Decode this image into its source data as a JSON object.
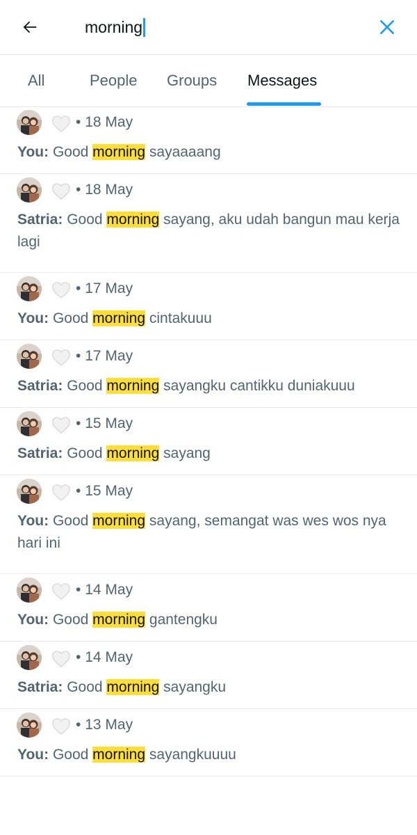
{
  "search": {
    "query": "morning"
  },
  "tabs": [
    {
      "label": "All"
    },
    {
      "label": "People"
    },
    {
      "label": "Groups"
    },
    {
      "label": "Messages"
    }
  ],
  "active_tab": "Messages",
  "colors": {
    "accent": "#1d9bf0",
    "highlight": "#ffde35",
    "secondary_text": "#536471",
    "divider": "#e7e9ea"
  },
  "results": [
    {
      "date": "18 May",
      "sender": "You:",
      "before": "Good",
      "match": "morning",
      "after": "sayaaaang"
    },
    {
      "date": "18 May",
      "sender": "Satria:",
      "before": "Good",
      "match": "morning",
      "after": "sayang, aku udah bangun mau kerja lagi"
    },
    {
      "date": "17 May",
      "sender": "You:",
      "before": "Good",
      "match": "morning",
      "after": "cintakuuu"
    },
    {
      "date": "17 May",
      "sender": "Satria:",
      "before": "Good",
      "match": "morning",
      "after": "sayangku cantikku duniakuuu"
    },
    {
      "date": "15 May",
      "sender": "Satria:",
      "before": "Good",
      "match": "morning",
      "after": "sayang"
    },
    {
      "date": "15 May",
      "sender": "You:",
      "before": "Good",
      "match": "morning",
      "after": "sayang, semangat was wes wos nya hari ini"
    },
    {
      "date": "14 May",
      "sender": "You:",
      "before": "Good",
      "match": "morning",
      "after": "gantengku"
    },
    {
      "date": "14 May",
      "sender": "Satria:",
      "before": "Good",
      "match": "morning",
      "after": "sayangku"
    },
    {
      "date": "13 May",
      "sender": "You:",
      "before": "Good",
      "match": "morning",
      "after": "sayangkuuuu"
    }
  ],
  "separator": "•"
}
